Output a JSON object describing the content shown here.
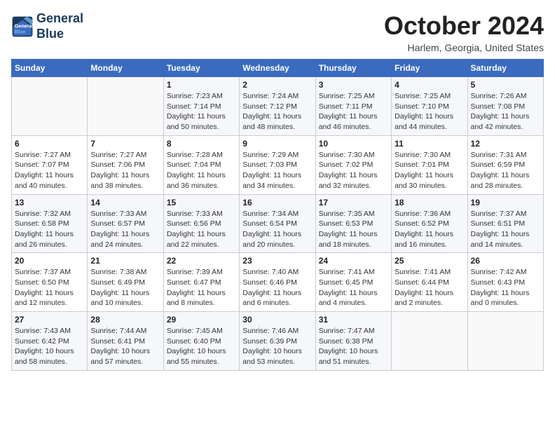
{
  "header": {
    "logo_line1": "General",
    "logo_line2": "Blue",
    "month": "October 2024",
    "location": "Harlem, Georgia, United States"
  },
  "days_of_week": [
    "Sunday",
    "Monday",
    "Tuesday",
    "Wednesday",
    "Thursday",
    "Friday",
    "Saturday"
  ],
  "weeks": [
    [
      {
        "day": "",
        "info": ""
      },
      {
        "day": "",
        "info": ""
      },
      {
        "day": "1",
        "info": "Sunrise: 7:23 AM\nSunset: 7:14 PM\nDaylight: 11 hours and 50 minutes."
      },
      {
        "day": "2",
        "info": "Sunrise: 7:24 AM\nSunset: 7:12 PM\nDaylight: 11 hours and 48 minutes."
      },
      {
        "day": "3",
        "info": "Sunrise: 7:25 AM\nSunset: 7:11 PM\nDaylight: 11 hours and 46 minutes."
      },
      {
        "day": "4",
        "info": "Sunrise: 7:25 AM\nSunset: 7:10 PM\nDaylight: 11 hours and 44 minutes."
      },
      {
        "day": "5",
        "info": "Sunrise: 7:26 AM\nSunset: 7:08 PM\nDaylight: 11 hours and 42 minutes."
      }
    ],
    [
      {
        "day": "6",
        "info": "Sunrise: 7:27 AM\nSunset: 7:07 PM\nDaylight: 11 hours and 40 minutes."
      },
      {
        "day": "7",
        "info": "Sunrise: 7:27 AM\nSunset: 7:06 PM\nDaylight: 11 hours and 38 minutes."
      },
      {
        "day": "8",
        "info": "Sunrise: 7:28 AM\nSunset: 7:04 PM\nDaylight: 11 hours and 36 minutes."
      },
      {
        "day": "9",
        "info": "Sunrise: 7:29 AM\nSunset: 7:03 PM\nDaylight: 11 hours and 34 minutes."
      },
      {
        "day": "10",
        "info": "Sunrise: 7:30 AM\nSunset: 7:02 PM\nDaylight: 11 hours and 32 minutes."
      },
      {
        "day": "11",
        "info": "Sunrise: 7:30 AM\nSunset: 7:01 PM\nDaylight: 11 hours and 30 minutes."
      },
      {
        "day": "12",
        "info": "Sunrise: 7:31 AM\nSunset: 6:59 PM\nDaylight: 11 hours and 28 minutes."
      }
    ],
    [
      {
        "day": "13",
        "info": "Sunrise: 7:32 AM\nSunset: 6:58 PM\nDaylight: 11 hours and 26 minutes."
      },
      {
        "day": "14",
        "info": "Sunrise: 7:33 AM\nSunset: 6:57 PM\nDaylight: 11 hours and 24 minutes."
      },
      {
        "day": "15",
        "info": "Sunrise: 7:33 AM\nSunset: 6:56 PM\nDaylight: 11 hours and 22 minutes."
      },
      {
        "day": "16",
        "info": "Sunrise: 7:34 AM\nSunset: 6:54 PM\nDaylight: 11 hours and 20 minutes."
      },
      {
        "day": "17",
        "info": "Sunrise: 7:35 AM\nSunset: 6:53 PM\nDaylight: 11 hours and 18 minutes."
      },
      {
        "day": "18",
        "info": "Sunrise: 7:36 AM\nSunset: 6:52 PM\nDaylight: 11 hours and 16 minutes."
      },
      {
        "day": "19",
        "info": "Sunrise: 7:37 AM\nSunset: 6:51 PM\nDaylight: 11 hours and 14 minutes."
      }
    ],
    [
      {
        "day": "20",
        "info": "Sunrise: 7:37 AM\nSunset: 6:50 PM\nDaylight: 11 hours and 12 minutes."
      },
      {
        "day": "21",
        "info": "Sunrise: 7:38 AM\nSunset: 6:49 PM\nDaylight: 11 hours and 10 minutes."
      },
      {
        "day": "22",
        "info": "Sunrise: 7:39 AM\nSunset: 6:47 PM\nDaylight: 11 hours and 8 minutes."
      },
      {
        "day": "23",
        "info": "Sunrise: 7:40 AM\nSunset: 6:46 PM\nDaylight: 11 hours and 6 minutes."
      },
      {
        "day": "24",
        "info": "Sunrise: 7:41 AM\nSunset: 6:45 PM\nDaylight: 11 hours and 4 minutes."
      },
      {
        "day": "25",
        "info": "Sunrise: 7:41 AM\nSunset: 6:44 PM\nDaylight: 11 hours and 2 minutes."
      },
      {
        "day": "26",
        "info": "Sunrise: 7:42 AM\nSunset: 6:43 PM\nDaylight: 11 hours and 0 minutes."
      }
    ],
    [
      {
        "day": "27",
        "info": "Sunrise: 7:43 AM\nSunset: 6:42 PM\nDaylight: 10 hours and 58 minutes."
      },
      {
        "day": "28",
        "info": "Sunrise: 7:44 AM\nSunset: 6:41 PM\nDaylight: 10 hours and 57 minutes."
      },
      {
        "day": "29",
        "info": "Sunrise: 7:45 AM\nSunset: 6:40 PM\nDaylight: 10 hours and 55 minutes."
      },
      {
        "day": "30",
        "info": "Sunrise: 7:46 AM\nSunset: 6:39 PM\nDaylight: 10 hours and 53 minutes."
      },
      {
        "day": "31",
        "info": "Sunrise: 7:47 AM\nSunset: 6:38 PM\nDaylight: 10 hours and 51 minutes."
      },
      {
        "day": "",
        "info": ""
      },
      {
        "day": "",
        "info": ""
      }
    ]
  ]
}
